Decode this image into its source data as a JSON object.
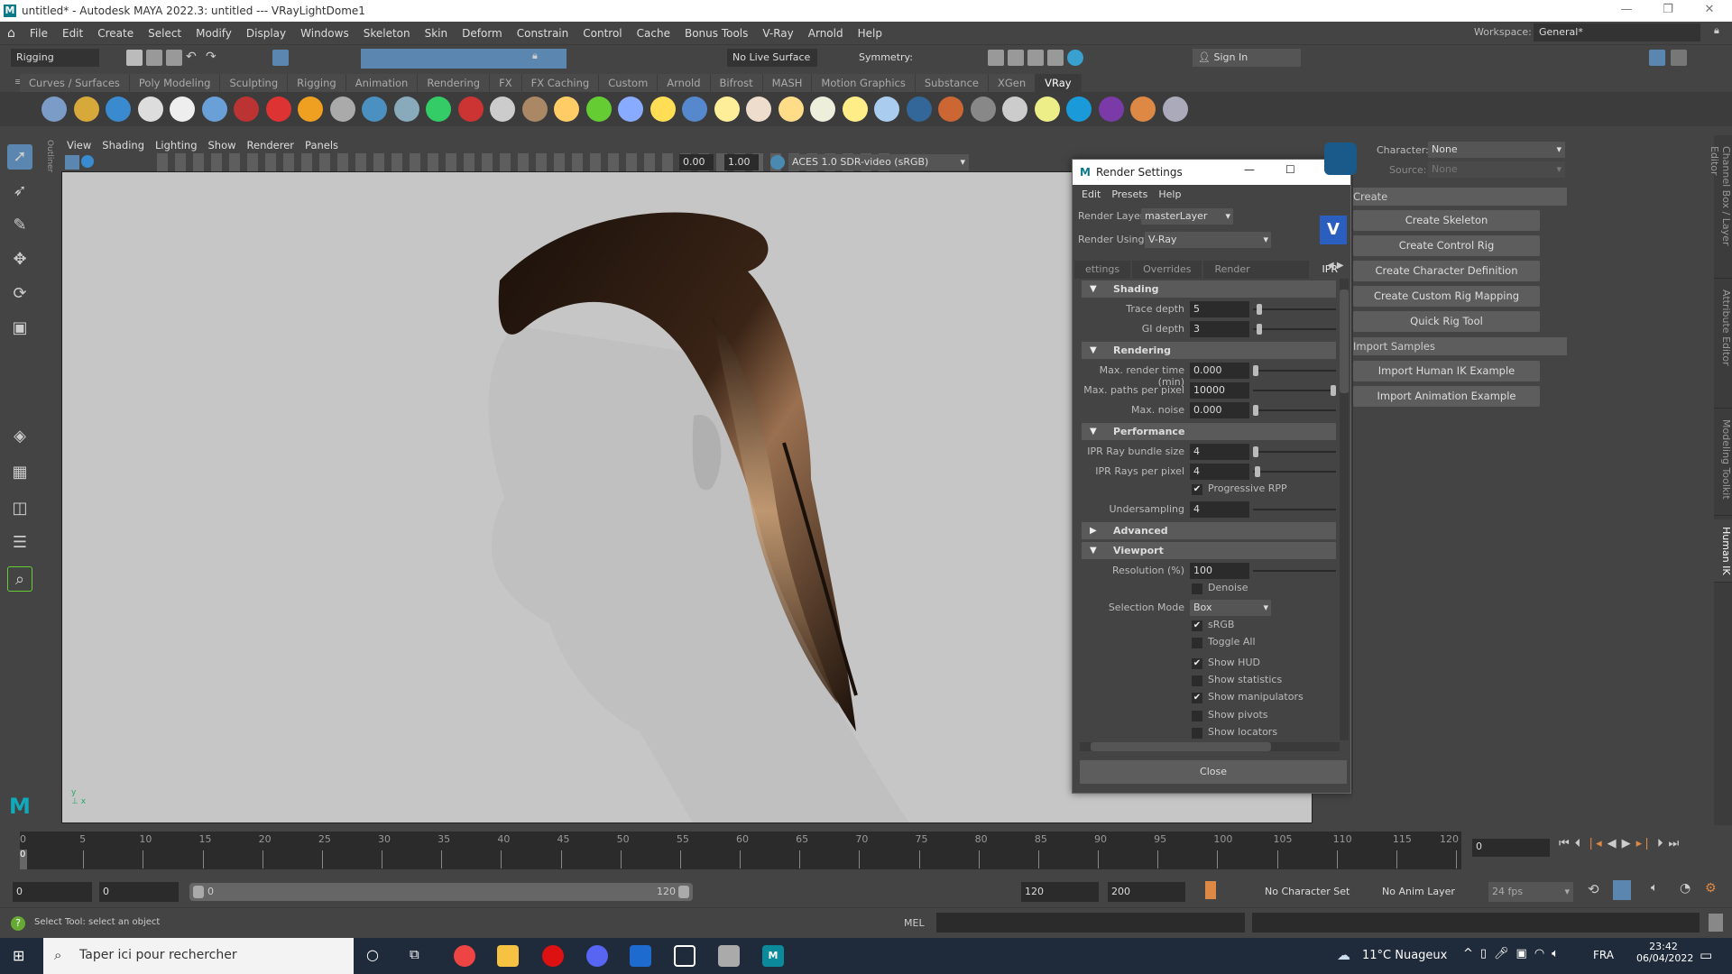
{
  "window": {
    "title": "untitled* - Autodesk MAYA 2022.3: untitled  ---  VRayLightDome1"
  },
  "menu": [
    "File",
    "Edit",
    "Create",
    "Select",
    "Modify",
    "Display",
    "Windows",
    "Skeleton",
    "Skin",
    "Deform",
    "Constrain",
    "Control",
    "Cache",
    "Bonus Tools",
    "V-Ray",
    "Arnold",
    "Help"
  ],
  "workspace": {
    "label": "Workspace:",
    "value": "General*"
  },
  "statusline": {
    "mode": "Rigging",
    "live_surface": "No Live Surface",
    "symmetry": "Symmetry: Off",
    "sign_in": "Sign In"
  },
  "shelf_tabs": [
    "Curves / Surfaces",
    "Poly Modeling",
    "Sculpting",
    "Rigging",
    "Animation",
    "Rendering",
    "FX",
    "FX Caching",
    "Custom",
    "Arnold",
    "Bifrost",
    "MASH",
    "Motion Graphics",
    "Substance",
    "XGen",
    "VRay"
  ],
  "shelf_active": "VRay",
  "shelf_icons": [
    {
      "name": "render-settings-icon",
      "color": "#7a9cc6"
    },
    {
      "name": "vfb-icon",
      "color": "#d6a93a"
    },
    {
      "name": "scene-tree-icon",
      "color": "#3a8ad0"
    },
    {
      "name": "plugin-icon",
      "color": "#ddd"
    },
    {
      "name": "file-icon",
      "color": "#eee"
    },
    {
      "name": "material-sphere-icon",
      "color": "#6aa0d8"
    },
    {
      "name": "camera-icon",
      "color": "#b33"
    },
    {
      "name": "balls-icon",
      "color": "#d33"
    },
    {
      "name": "fire-icon",
      "color": "#f0a020"
    },
    {
      "name": "proxy-icon",
      "color": "#aaa"
    },
    {
      "name": "sphere-light-icon",
      "color": "#4a90c0"
    },
    {
      "name": "cone-icon",
      "color": "#8ab"
    },
    {
      "name": "geometry-icon",
      "color": "#3c6"
    },
    {
      "name": "hair-icon",
      "color": "#c33"
    },
    {
      "name": "sphere-fade-icon",
      "color": "#ccc"
    },
    {
      "name": "texture-icon",
      "color": "#a86"
    },
    {
      "name": "dome-grid-icon",
      "color": "#fc6"
    },
    {
      "name": "fur-icon",
      "color": "#6c3"
    },
    {
      "name": "scatter-icon",
      "color": "#8af"
    },
    {
      "name": "curves-icon",
      "color": "#fd5"
    },
    {
      "name": "sphere-blue-icon",
      "color": "#58c"
    },
    {
      "name": "dome-light-icon",
      "color": "#fe9"
    },
    {
      "name": "spot-light-icon",
      "color": "#edc"
    },
    {
      "name": "sphere-light2-icon",
      "color": "#fd8"
    },
    {
      "name": "ies-light-icon",
      "color": "#eed"
    },
    {
      "name": "sun-icon",
      "color": "#fe8"
    },
    {
      "name": "rect-light-icon",
      "color": "#ace"
    },
    {
      "name": "blue-sphere-icon",
      "color": "#369"
    },
    {
      "name": "split-sphere-icon",
      "color": "#c63"
    },
    {
      "name": "checker-icon",
      "color": "#888"
    },
    {
      "name": "vfb-window-icon",
      "color": "#ccc"
    },
    {
      "name": "light-lister-icon",
      "color": "#ee8"
    },
    {
      "name": "cloud-icon",
      "color": "#1a9ad8"
    },
    {
      "name": "palette-icon",
      "color": "#7a3aa8"
    },
    {
      "name": "color-balls-icon",
      "color": "#d84"
    },
    {
      "name": "help-icon",
      "color": "#aab"
    }
  ],
  "panel_menu": [
    "View",
    "Shading",
    "Lighting",
    "Show",
    "Renderer",
    "Panels"
  ],
  "viewport_toolbar": {
    "exposure": "0.00",
    "gamma": "1.00",
    "color_space": "ACES 1.0 SDR-video (sRGB)"
  },
  "render_settings": {
    "title": "Render Settings",
    "menu": [
      "Edit",
      "Presets",
      "Help"
    ],
    "render_layer_label": "Render Layer",
    "render_layer": "masterLayer",
    "render_using_label": "Render Using",
    "render_using": "V-Ray",
    "tabs": [
      "ettings",
      "Overrides",
      "Render Elements",
      "IPR"
    ],
    "active_tab": "IPR",
    "sections": {
      "shading": {
        "title": "Shading",
        "trace_depth_label": "Trace depth",
        "trace_depth": "5",
        "gi_depth_label": "GI depth",
        "gi_depth": "3"
      },
      "rendering": {
        "title": "Rendering",
        "max_time_label": "Max. render time (min)",
        "max_time": "0.000",
        "max_paths_label": "Max. paths per pixel",
        "max_paths": "10000",
        "max_noise_label": "Max. noise",
        "max_noise": "0.000"
      },
      "performance": {
        "title": "Performance",
        "bundle_label": "IPR Ray bundle size",
        "bundle": "4",
        "rays_label": "IPR Rays per pixel",
        "rays": "4",
        "progressive_label": "Progressive RPP",
        "undersampling_label": "Undersampling",
        "undersampling": "4"
      },
      "advanced": {
        "title": "Advanced"
      },
      "viewport": {
        "title": "Viewport",
        "resolution_label": "Resolution (%)",
        "resolution": "100",
        "denoise_label": "Denoise",
        "selection_mode_label": "Selection Mode",
        "selection_mode": "Box",
        "checks": [
          {
            "label": "sRGB",
            "checked": true
          },
          {
            "label": "Toggle All",
            "checked": false
          },
          {
            "label": "Show HUD",
            "checked": true
          },
          {
            "label": "Show statistics",
            "checked": false
          },
          {
            "label": "Show manipulators",
            "checked": true
          },
          {
            "label": "Show pivots",
            "checked": false
          },
          {
            "label": "Show locators",
            "checked": false
          }
        ]
      }
    },
    "close": "Close"
  },
  "human_ik": {
    "character_label": "Character:",
    "character": "None",
    "source_label": "Source:",
    "source": "None",
    "create_section": "Create",
    "create_buttons": [
      "Create Skeleton",
      "Create Control Rig",
      "Create Character Definition",
      "Create Custom Rig Mapping",
      "Quick Rig Tool"
    ],
    "import_section": "Import Samples",
    "import_buttons": [
      "Import Human IK Example",
      "Import Animation Example"
    ]
  },
  "side_tabs": [
    "Channel Box / Layer Editor",
    "Attribute Editor",
    "Modeling Toolkit",
    "Human IK"
  ],
  "timeline": {
    "ticks": [
      0,
      5,
      10,
      15,
      20,
      25,
      30,
      35,
      40,
      45,
      50,
      55,
      60,
      65,
      70,
      75,
      80,
      85,
      90,
      95,
      100,
      105,
      110,
      115,
      120
    ],
    "current_frame": "0",
    "frame_field": "0"
  },
  "range": {
    "start": "0",
    "playback_start": "0",
    "slider_start": "0",
    "slider_end": "120",
    "playback_end": "120",
    "end": "200",
    "character_set": "No Character Set",
    "anim_layer": "No Anim Layer",
    "fps": "24 fps"
  },
  "command": {
    "help": "Select Tool: select an object",
    "mel": "MEL"
  },
  "taskbar": {
    "search": "Taper ici pour rechercher",
    "weather": "11°C  Nuageux",
    "lang": "FRA",
    "time": "23:42",
    "date": "06/04/2022"
  }
}
